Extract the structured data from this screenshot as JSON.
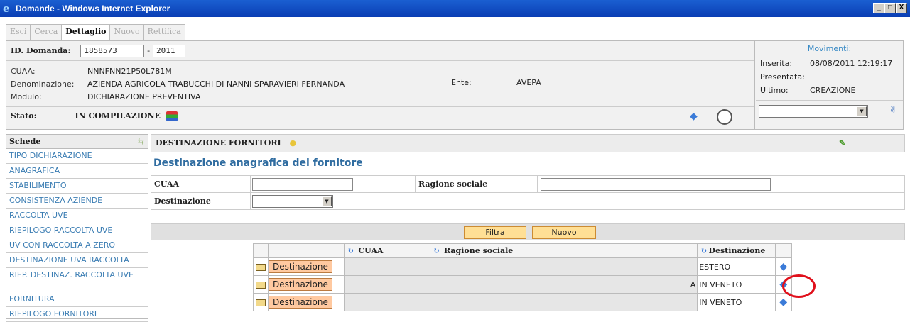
{
  "window": {
    "title": "Domande - Windows Internet Explorer",
    "controls": [
      "_",
      "□",
      "X"
    ]
  },
  "tabs": [
    {
      "label": "Esci",
      "active": false
    },
    {
      "label": "Cerca",
      "active": false
    },
    {
      "label": "Dettaglio",
      "active": true
    },
    {
      "label": "Nuovo",
      "active": false
    },
    {
      "label": "Rettifica",
      "active": false
    }
  ],
  "header": {
    "id_label": "ID. Domanda:",
    "id_value": "1858573",
    "year_sep": "-",
    "year_value": "2011",
    "cuaa_label": "CUAA:",
    "cuaa_value": "NNNFNN21P50L781M",
    "den_label": "Denominazione:",
    "den_value": "AZIENDA AGRICOLA TRABUCCHI DI NANNI SPARAVIERI FERNANDA",
    "ente_label": "Ente:",
    "ente_value": "AVEPA",
    "modulo_label": "Modulo:",
    "modulo_value": "DICHIARAZIONE PREVENTIVA",
    "stato_label": "Stato:",
    "stato_value": "IN COMPILAZIONE"
  },
  "movimenti": {
    "title": "Movimenti:",
    "inserita_label": "Inserita:",
    "inserita_value": "08/08/2011 12:19:17",
    "presentata_label": "Presentata:",
    "presentata_value": "",
    "ultimo_label": "Ultimo:",
    "ultimo_value": "CREAZIONE"
  },
  "schede": {
    "title": "Schede",
    "items": [
      "TIPO DICHIARAZIONE",
      "ANAGRAFICA",
      "STABILIMENTO",
      "CONSISTENZA AZIENDE",
      "RACCOLTA UVE",
      "RIEPILOGO RACCOLTA UVE",
      "UV CON RACCOLTA A ZERO",
      "DESTINAZIONE UVA RACCOLTA",
      "RIEP. DESTINAZ. RACCOLTA UVE",
      "FORNITURA",
      "RIEPILOGO FORNITORI"
    ]
  },
  "main": {
    "section_title": "DESTINAZIONE FORNITORI",
    "subtitle": "Destinazione anagrafica del fornitore",
    "filter": {
      "cuaa_label": "CUAA",
      "ragione_label": "Ragione sociale",
      "destinazione_label": "Destinazione",
      "filtra_label": "Filtra",
      "nuovo_label": "Nuovo"
    },
    "grid": {
      "col_cuaa": "CUAA",
      "col_ragione": "Ragione sociale",
      "col_destinazione": "Destinazione",
      "rows": [
        {
          "button": "Destinazione",
          "trail": "",
          "destinazione": "ESTERO"
        },
        {
          "button": "Destinazione",
          "trail": "A",
          "destinazione": "IN VENETO"
        },
        {
          "button": "Destinazione",
          "trail": "",
          "destinazione": "IN VENETO"
        }
      ]
    }
  }
}
